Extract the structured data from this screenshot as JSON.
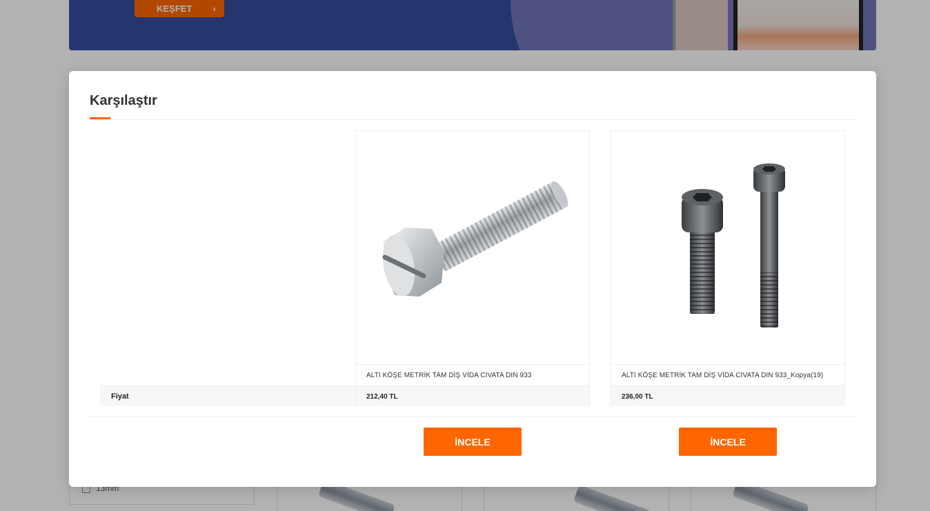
{
  "banner": {
    "cta_label": "KEŞFET",
    "cta_icon": "chevron-right-icon"
  },
  "filter": {
    "option_label": "13mm"
  },
  "modal": {
    "title": "Karşılaştır"
  },
  "rows": {
    "price_label": "Fiyat"
  },
  "products": [
    {
      "name": "ALTI KÖŞE METRİK TAM DİŞ VİDA CIVATA DIN 933",
      "price": "212,40 TL",
      "button_label": "İNCELE",
      "image": "slotted-hex-bolt-image"
    },
    {
      "name": "ALTI KÖŞE METRİK TAM DİŞ VİDA CIVATA DIN 933_Kopya(19)",
      "price": "236,00 TL",
      "button_label": "İNCELE",
      "image": "socket-head-cap-screws-image"
    }
  ],
  "colors": {
    "accent": "#ff6600",
    "banner": "#344e9c",
    "overlay": "rgba(0,0,0,0.3)"
  }
}
